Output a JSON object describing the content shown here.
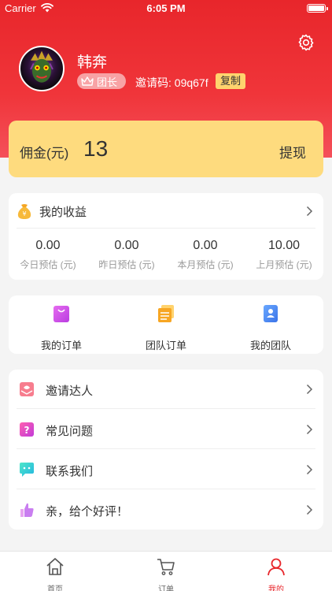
{
  "status_bar": {
    "carrier": "Carrier",
    "time": "6:05 PM"
  },
  "profile": {
    "name": "韩奔",
    "role": "团长",
    "invite_label": "邀请码: 09q67f",
    "copy_label": "复制"
  },
  "commission": {
    "label": "佣金(元)",
    "value": "13",
    "withdraw_label": "提现"
  },
  "earnings": {
    "title": "我的收益",
    "stats": [
      {
        "value": "0.00",
        "label": "今日预估 (元)"
      },
      {
        "value": "0.00",
        "label": "昨日预估 (元)"
      },
      {
        "value": "0.00",
        "label": "本月预估 (元)"
      },
      {
        "value": "10.00",
        "label": "上月预估 (元)"
      }
    ]
  },
  "orders": {
    "items": [
      {
        "label": "我的订单",
        "icon": "shopping-bag-icon"
      },
      {
        "label": "团队订单",
        "icon": "stacked-cards-icon"
      },
      {
        "label": "我的团队",
        "icon": "contacts-book-icon"
      }
    ]
  },
  "menu": {
    "items": [
      {
        "label": "邀请达人",
        "icon": "invite-envelope-icon"
      },
      {
        "label": "常见问题",
        "icon": "question-icon"
      },
      {
        "label": "联系我们",
        "icon": "contact-chat-icon"
      },
      {
        "label": "亲，给个好评！",
        "icon": "thumbs-up-icon"
      }
    ]
  },
  "tabs": [
    {
      "label": "首页",
      "icon": "home-icon",
      "active": false
    },
    {
      "label": "订单",
      "icon": "cart-icon",
      "active": false
    },
    {
      "label": "我的",
      "icon": "user-icon",
      "active": true
    }
  ],
  "colors": {
    "brand_red": "#e8262b",
    "commission_yellow": "#fedb7e",
    "copy_yellow": "#ffd36e",
    "background": "#f4f4f4"
  }
}
